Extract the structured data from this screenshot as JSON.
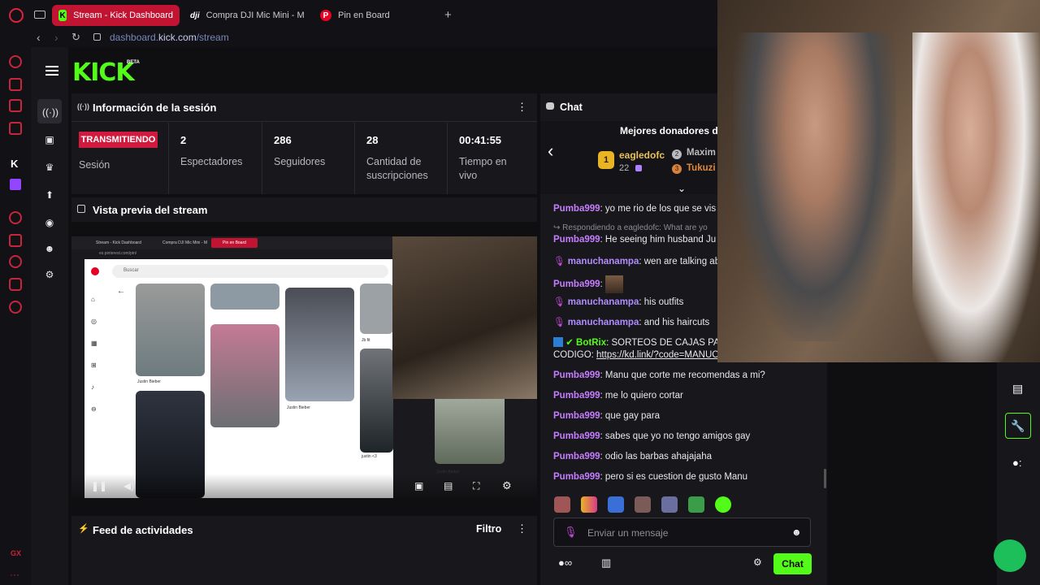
{
  "browser": {
    "tabs": [
      {
        "label": "Stream - Kick Dashboard",
        "active": true
      },
      {
        "label": "Compra DJI Mic Mini - M",
        "active": false
      },
      {
        "label": "Pin en Board",
        "active": false
      }
    ],
    "url_prefix": "dashboard.",
    "url_domain": "kick.com",
    "url_path": "/stream"
  },
  "brand": {
    "logo": "KICK",
    "beta": "BETA",
    "accent": "#53fc18",
    "live_color": "#d11a3d"
  },
  "session": {
    "title": "Información de la sesión",
    "status": "TRANSMITIENDO",
    "status_label": "Sesión",
    "stats": [
      {
        "value": "2",
        "label": "Espectadores"
      },
      {
        "value": "286",
        "label": "Seguidores"
      },
      {
        "value": "28",
        "label": "Cantidad de suscripciones"
      },
      {
        "value": "00:41:55",
        "label": "Tiempo en vivo"
      }
    ]
  },
  "preview": {
    "title": "Vista previa del stream",
    "inner_tabs": [
      "Stream - Kick Dashboard",
      "Compra DJI Mic Mini - M",
      "Pin en Board"
    ],
    "inner_url": "es.pinterest.com/pin/",
    "search_placeholder": "Buscar",
    "captions": [
      "Justin Bieber",
      "Justin Bieber",
      "Jb fit",
      "justin <3",
      "Justin Bieber"
    ]
  },
  "feed": {
    "title": "Feed de actividades",
    "filter_label": "Filtro"
  },
  "chat": {
    "title": "Chat",
    "donors_title": "Mejores donadores d",
    "donors": [
      {
        "rank": "1",
        "name": "eagledofc",
        "amount": "22"
      },
      {
        "rank": "2",
        "name": "Maxim"
      },
      {
        "rank": "3",
        "name": "Tukuzi"
      }
    ],
    "messages": [
      {
        "user": "Pumba999",
        "text": ": yo me rio de los que se vis",
        "kind": "pumba"
      },
      {
        "reply": "Respondiendo a eagledofc: What are yo"
      },
      {
        "user": "Pumba999",
        "text": ": He seeing him husband Ju",
        "kind": "pumba"
      },
      {
        "user": "manuchanampa",
        "text": ": wen are talking ab",
        "kind": "manu"
      },
      {
        "user": "Pumba999",
        "text": ":",
        "kind": "pumba"
      },
      {
        "user": "manuchanampa",
        "text": ": his outfits",
        "kind": "manu"
      },
      {
        "user": "manuchanampa",
        "text": ": and his haircuts",
        "kind": "manu"
      },
      {
        "user": "BotRix",
        "text": ": SORTEOS DE CAJAS PA",
        "kind": "bot"
      },
      {
        "line2": "CODIGO: ",
        "link": "https://kd.link/?code=MANUC"
      },
      {
        "user": "Pumba999",
        "text": ": Manu que corte me recomendas a mi?",
        "kind": "pumba"
      },
      {
        "user": "Pumba999",
        "text": ": me lo quiero cortar",
        "kind": "pumba"
      },
      {
        "user": "Pumba999",
        "text": ": que gay para",
        "kind": "pumba"
      },
      {
        "user": "Pumba999",
        "text": ": sabes que yo no tengo amigos gay",
        "kind": "pumba"
      },
      {
        "user": "Pumba999",
        "text": ": odio las barbas ahajajaha",
        "kind": "pumba"
      },
      {
        "user": "Pumba999",
        "text": ": pero si es cuestion de gusto Manu",
        "kind": "pumba"
      }
    ],
    "input_placeholder": "Enviar un mensaje",
    "send_label": "Chat"
  },
  "opera": {
    "gx_label": "GX"
  }
}
